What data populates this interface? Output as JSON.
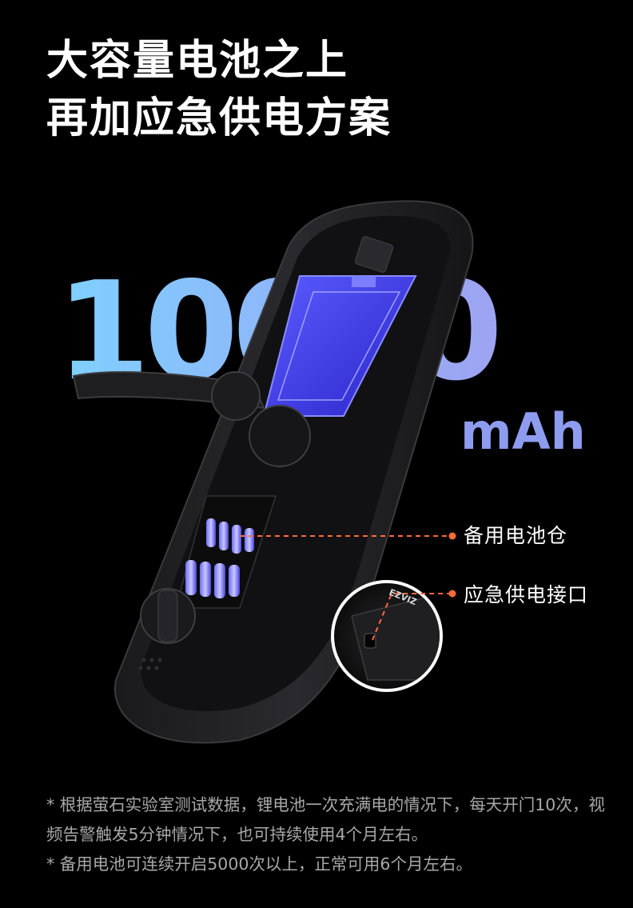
{
  "headline": {
    "line1": "大容量电池之上",
    "line2": "再加应急供电方案"
  },
  "capacity": {
    "value": "10000",
    "unit": "mAh"
  },
  "callouts": {
    "battery_compartment": "备用电池仓",
    "emergency_port": "应急供电接口"
  },
  "inset_brand": "EZVIZ",
  "footnotes": {
    "note1": "* 根据萤石实验室测试数据，锂电池一次充满电的情况下，每天开门10次，视频告警触发5分钟情况下，也可持续使用4个月左右。",
    "note2": "* 备用电池可连续开启5000次以上，正常可用6个月左右。"
  },
  "colors": {
    "background": "#000000",
    "number_gradient_start": "#7fd0ff",
    "number_gradient_end": "#a799ee",
    "battery_blue": "#3a3ae8",
    "callout_line": "#ff6a3d"
  }
}
